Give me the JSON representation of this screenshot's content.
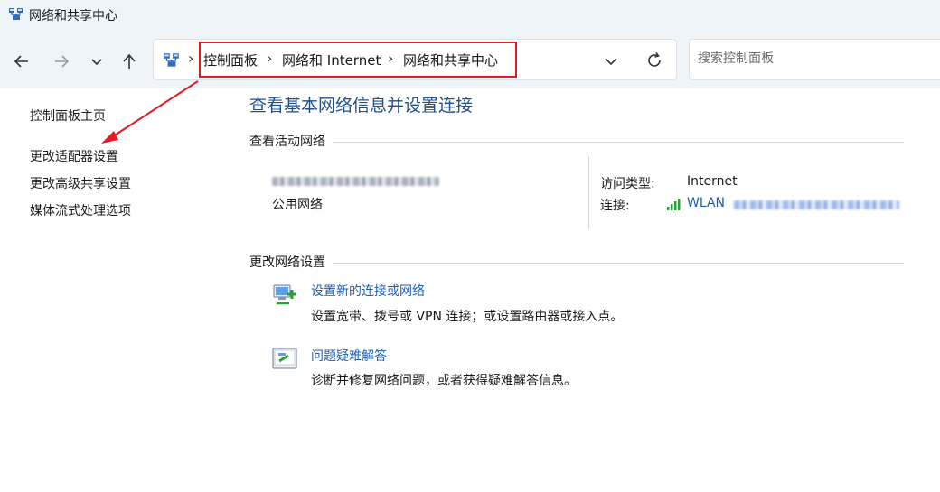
{
  "window": {
    "title": "网络和共享中心"
  },
  "nav": {
    "back_icon": "arrow-left-icon",
    "forward_icon": "arrow-right-icon",
    "recent_icon": "chevron-down-icon",
    "up_icon": "arrow-up-icon"
  },
  "address": {
    "crumbs": [
      "控制面板",
      "网络和 Internet",
      "网络和共享中心"
    ],
    "separator": "›",
    "highlight_color": "#e31b23"
  },
  "search": {
    "placeholder": "搜索控制面板"
  },
  "sidebar": {
    "items": [
      {
        "label": "控制面板主页"
      },
      {
        "label": "更改适配器设置"
      },
      {
        "label": "更改高级共享设置"
      },
      {
        "label": "媒体流式处理选项"
      }
    ]
  },
  "main": {
    "title": "查看基本网络信息并设置连接",
    "active_section": "查看活动网络",
    "network_type": "公用网络",
    "access_type_label": "访问类型:",
    "access_type_value": "Internet",
    "connection_label": "连接:",
    "connection_value": "WLAN",
    "change_section": "更改网络设置",
    "tasks": [
      {
        "title": "设置新的连接或网络",
        "desc": "设置宽带、拨号或 VPN 连接；或设置路由器或接入点。"
      },
      {
        "title": "问题疑难解答",
        "desc": "诊断并修复网络问题，或者获得疑难解答信息。"
      }
    ]
  },
  "colors": {
    "link": "#1a5fb4",
    "heading": "#1e4f8c",
    "annotation": "#e31b23"
  }
}
